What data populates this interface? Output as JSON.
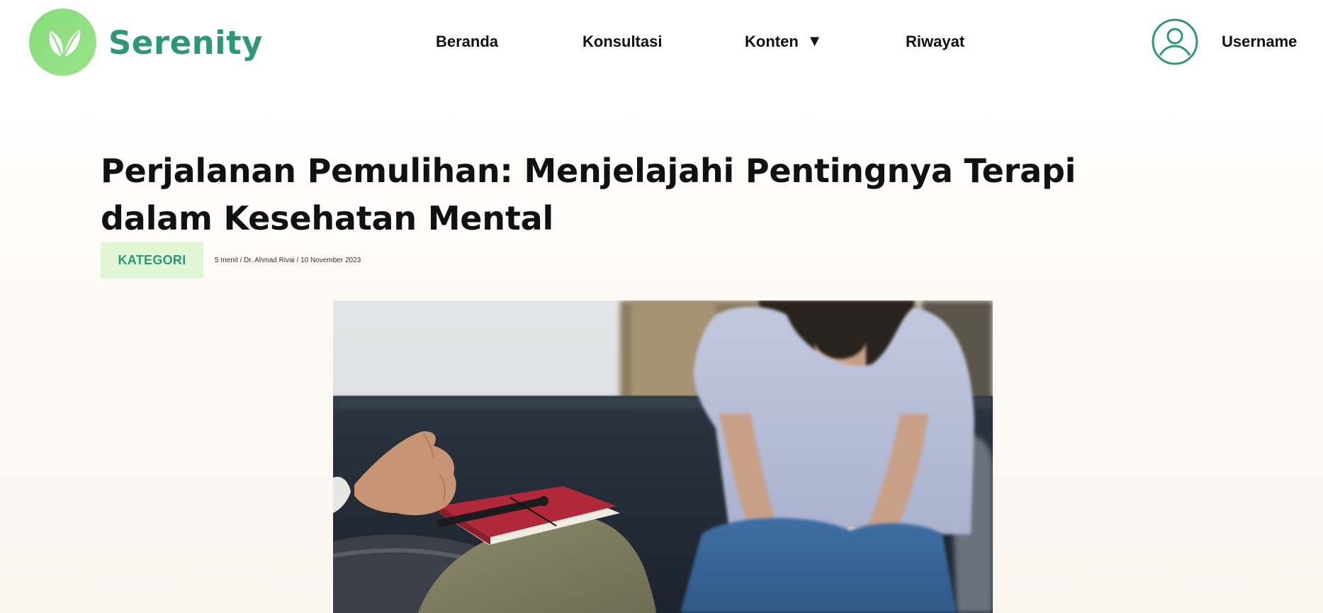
{
  "brand": {
    "name": "Serenity",
    "logo_icon": "leaf-logo-icon",
    "colors": {
      "primary": "#2e9777",
      "logo_bg": "#8fdf80"
    }
  },
  "nav": {
    "items": [
      {
        "label": "Beranda"
      },
      {
        "label": "Konsultasi"
      },
      {
        "label": "Konten",
        "has_dropdown": true,
        "dropdown_icon": "caret-down-icon"
      },
      {
        "label": "Riwayat"
      }
    ]
  },
  "user": {
    "name": "Username",
    "icon": "user-circle-icon"
  },
  "article": {
    "title": "Perjalanan Pemulihan: Menjelajahi Pentingnya Terapi dalam Kesehatan Mental",
    "category": "KATEGORI",
    "meta": "5 menit / Dr. Ahmad Rivai / 10 November 2023",
    "category_colors": {
      "bg": "#e1f6d4",
      "text": "#2e9777"
    }
  }
}
